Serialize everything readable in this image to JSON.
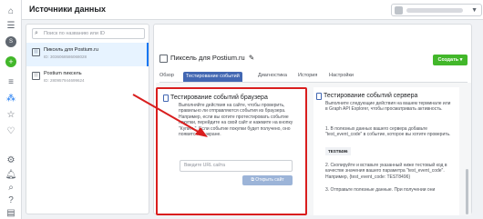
{
  "header": {
    "title": "Источники данных"
  },
  "rail": {
    "icons": [
      "home-icon",
      "menu-icon",
      "profile-icon",
      "add-icon",
      "list-icon",
      "events-icon",
      "star-icon",
      "heart-icon",
      "settings-icon",
      "bell-icon",
      "search-icon",
      "help-icon",
      "panel-icon"
    ]
  },
  "sidebar": {
    "search_placeholder": "Поиск по названию или ID",
    "pixels": [
      {
        "name": "Пиксель для Postium.ru",
        "id": "ID: 3036068586068028"
      },
      {
        "name": "Postium пиксель",
        "id": "ID: 280957944699624"
      }
    ]
  },
  "main": {
    "title": "Пиксель для Postium.ru",
    "create_button": "Создать",
    "tabs": [
      "Обзор",
      "Тестирование событий",
      "Диагностика",
      "История",
      "Настройки"
    ],
    "active_tab": 1,
    "browser_card": {
      "title": "Тестирование событий браузера",
      "description": "Выполняйте действия на сайте, чтобы проверить, правильно ли отправляются события из браузера. Например, если вы хотите протестировать событие покупки, перейдите на свой сайт и нажмите на кнопку \"Купить\". Если событие покупки будет получено, оно появится на экране.",
      "url_placeholder": "Введите URL сайта",
      "open_button": "Открыть сайт"
    },
    "server_card": {
      "title": "Тестирование событий сервера",
      "description": "Выполните следующие действия на вашем терминале или в Graph API Explorer, чтобы просматривать активность.",
      "step1": "1. В полезных данных вашего сервера добавьте \"test_event_code\" в событие, которое вы хотите проверить.",
      "code": "TEST8496",
      "step2": "2. Скопируйте и вставьте указанный ниже тестовый код в качестве значения вашего параметра \"test_event_code\". Например, {test_event_code: TEST8496}",
      "step3": "3. Отправьте полезные данные. При получении они"
    }
  },
  "colors": {
    "accent": "#4267b2",
    "create": "#42b72a",
    "highlight": "#d91e1e"
  }
}
